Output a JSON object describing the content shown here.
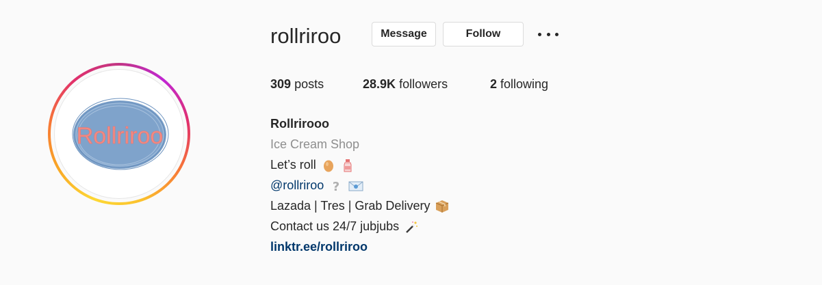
{
  "profile": {
    "username": "rollriroo",
    "avatar_text": "Rollriroo",
    "message_label": "Message",
    "follow_label": "Follow"
  },
  "stats": {
    "posts_count": "309",
    "posts_label": "posts",
    "followers_count": "28.9K",
    "followers_label": "followers",
    "following_count": "2",
    "following_label": "following"
  },
  "bio": {
    "name": "Rollrirooo",
    "category": "Ice Cream Shop",
    "line1": "Let’s roll",
    "line1_icons": [
      "egg-icon",
      "milk-bottle-icon"
    ],
    "mention": "@rollriroo",
    "mention_icons": [
      "question-mark-icon",
      "envelope-icon"
    ],
    "delivery": "Lazada | Tres | Grab Delivery",
    "delivery_icon": "package-icon",
    "contact": "Contact us 24/7 jubjubs",
    "contact_icon": "magic-wand-icon",
    "link": "linktr.ee/rollriroo"
  },
  "colors": {
    "background": "#fafafa",
    "text": "#262626",
    "muted": "#8e8e8e",
    "link": "#00376b",
    "avatar_blob": "#7ea2c9"
  }
}
